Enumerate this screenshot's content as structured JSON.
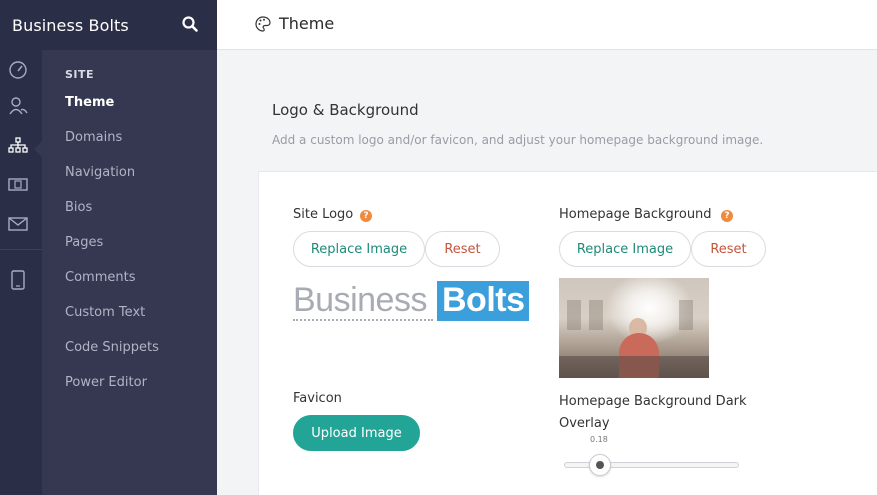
{
  "app": {
    "name": "Business Bolts"
  },
  "header": {
    "title": "Theme"
  },
  "sidebar": {
    "section": "SITE",
    "items": [
      {
        "label": "Theme",
        "active": true
      },
      {
        "label": "Domains"
      },
      {
        "label": "Navigation"
      },
      {
        "label": "Bios"
      },
      {
        "label": "Pages"
      },
      {
        "label": "Comments"
      },
      {
        "label": "Custom Text"
      },
      {
        "label": "Code Snippets"
      },
      {
        "label": "Power Editor"
      }
    ]
  },
  "rail_icons": [
    "dashboard-icon",
    "people-icon",
    "sitemap-icon",
    "money-icon",
    "mail-icon",
    "tablet-icon"
  ],
  "section": {
    "title": "Logo & Background",
    "description": "Add a custom logo and/or favicon, and adjust your homepage background image."
  },
  "site_logo": {
    "label": "Site Logo",
    "help": "?",
    "replace_label": "Replace Image",
    "reset_label": "Reset",
    "logo_text_1": "Business",
    "logo_text_2": "Bolts"
  },
  "homepage_background": {
    "label": "Homepage Background",
    "help": "?",
    "replace_label": "Replace Image",
    "reset_label": "Reset"
  },
  "favicon": {
    "label": "Favicon",
    "upload_label": "Upload Image"
  },
  "dark_overlay": {
    "label": "Homepage Background Dark Overlay",
    "value": "0.18"
  },
  "colors": {
    "nav_dark": "#2b2e47",
    "subnav": "#353850",
    "accent_teal": "#22a597",
    "reset_red": "#c4553d",
    "help_orange": "#f08a3c",
    "logo_blue": "#3b9fdb"
  }
}
